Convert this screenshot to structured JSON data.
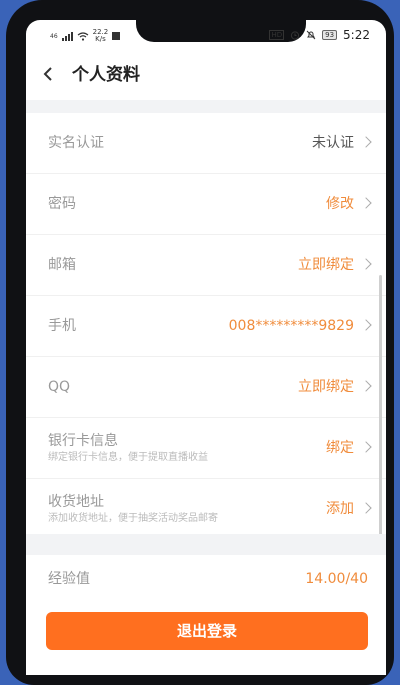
{
  "status_bar": {
    "signal_text": "46",
    "speed_value": "22.2",
    "speed_unit": "K/s",
    "hd_label": "HD",
    "battery": "93",
    "time": "5:22"
  },
  "header": {
    "back_icon": "chevron-left-icon",
    "title": "个人资料"
  },
  "rows": [
    {
      "label": "实名认证",
      "value": "未认证",
      "value_color": "#555555"
    },
    {
      "label": "密码",
      "value": "修改",
      "value_color": "#f08c3c"
    },
    {
      "label": "邮箱",
      "value": "立即绑定",
      "value_color": "#f08c3c"
    },
    {
      "label": "手机",
      "value": "008*********9829",
      "value_color": "#f08c3c"
    },
    {
      "label": "QQ",
      "value": "立即绑定",
      "value_color": "#f08c3c"
    },
    {
      "label": "银行卡信息",
      "sub": "绑定银行卡信息，便于提取直播收益",
      "value": "绑定",
      "value_color": "#f08c3c"
    },
    {
      "label": "收货地址",
      "sub": "添加收货地址，便于抽奖活动奖品邮寄",
      "value": "添加",
      "value_color": "#f08c3c"
    }
  ],
  "experience": {
    "label": "经验值",
    "value": "14.00/40"
  },
  "logout_button": "退出登录",
  "colors": {
    "accent": "#ff6f1f",
    "value_orange": "#f08c3c",
    "phone_background": "#3a63b8"
  }
}
